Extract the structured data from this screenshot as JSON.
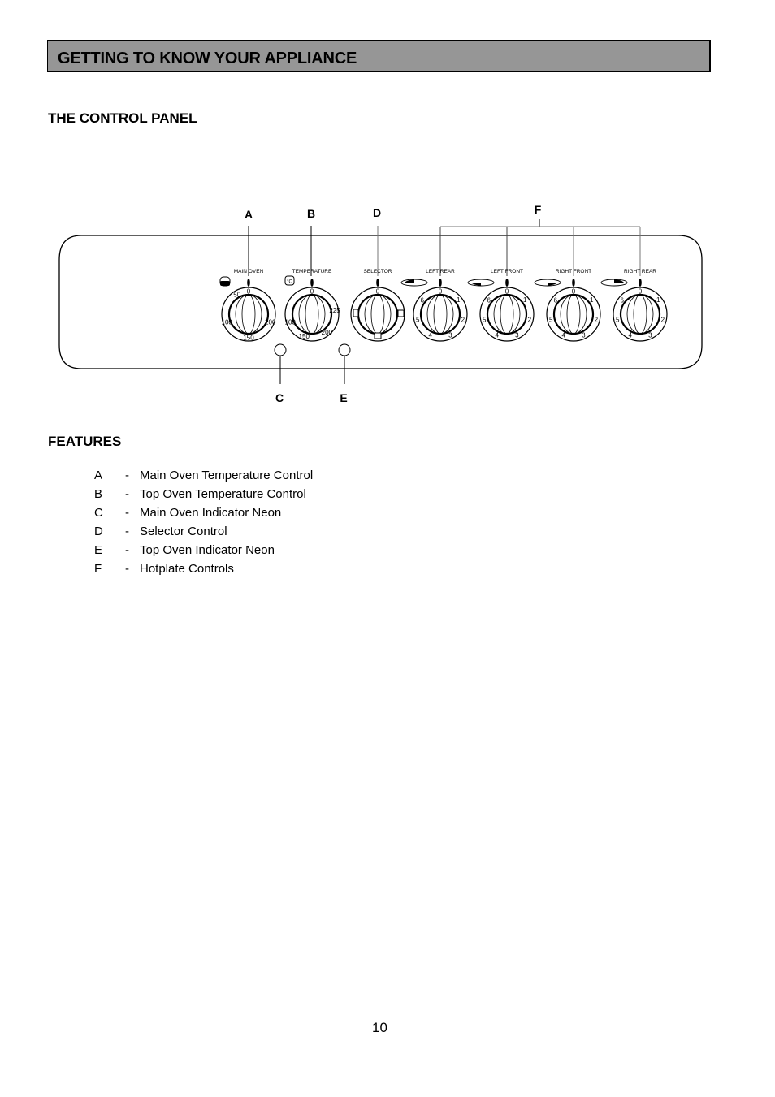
{
  "header": {
    "title": "GETTING TO KNOW YOUR APPLIANCE",
    "bar_color": "#969696"
  },
  "control_panel": {
    "heading": "THE CONTROL PANEL",
    "callouts": {
      "A": "A",
      "B": "B",
      "C": "C",
      "D": "D",
      "E": "E",
      "F": "F"
    },
    "knobs": [
      {
        "id": "main-oven",
        "label": "MAIN OVEN",
        "icon": "oven-icon",
        "callout": "A",
        "marks": [
          "0",
          "50",
          "100",
          "150",
          "200"
        ]
      },
      {
        "id": "temperature",
        "label": "TEMPERATURE",
        "icon": "thermometer-icon",
        "callout": "B",
        "marks": [
          "0",
          "100",
          "150",
          "200",
          "225"
        ]
      },
      {
        "id": "selector",
        "label": "SELECTOR",
        "icon": "",
        "callout": "D",
        "marks": [
          "0"
        ]
      },
      {
        "id": "left-rear",
        "label": "LEFT REAR",
        "icon": "hotplate-left-rear-icon",
        "callout": "F",
        "marks": [
          "0",
          "1",
          "2",
          "3",
          "4",
          "5",
          "6"
        ]
      },
      {
        "id": "left-front",
        "label": "LEFT FRONT",
        "icon": "hotplate-left-front-icon",
        "callout": "F",
        "marks": [
          "0",
          "1",
          "2",
          "3",
          "4",
          "5",
          "6"
        ]
      },
      {
        "id": "right-front",
        "label": "RIGHT FRONT",
        "icon": "hotplate-right-front-icon",
        "callout": "F",
        "marks": [
          "0",
          "1",
          "2",
          "3",
          "4",
          "5",
          "6"
        ]
      },
      {
        "id": "right-rear",
        "label": "RIGHT REAR",
        "icon": "hotplate-right-rear-icon",
        "callout": "F",
        "marks": [
          "0",
          "1",
          "2",
          "3",
          "4",
          "5",
          "6"
        ]
      }
    ]
  },
  "features": {
    "heading": "FEATURES",
    "items": [
      {
        "letter": "A",
        "dash": "-",
        "text": "Main Oven Temperature Control"
      },
      {
        "letter": "B",
        "dash": "-",
        "text": "Top Oven Temperature Control"
      },
      {
        "letter": "C",
        "dash": "-",
        "text": "Main Oven Indicator Neon"
      },
      {
        "letter": "D",
        "dash": "-",
        "text": "Selector Control"
      },
      {
        "letter": "E",
        "dash": "-",
        "text": "Top Oven Indicator Neon"
      },
      {
        "letter": "F",
        "dash": "-",
        "text": "Hotplate Controls"
      }
    ]
  },
  "footer": {
    "page_number": "10"
  }
}
